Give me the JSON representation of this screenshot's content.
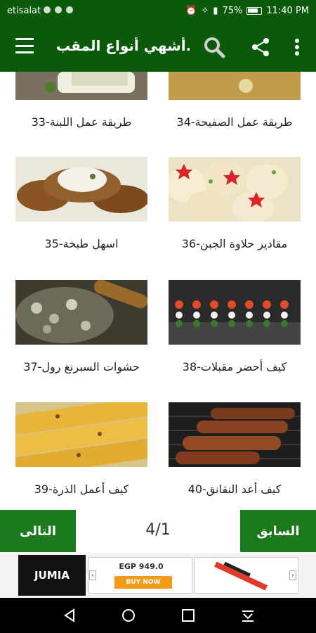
{
  "status_bar": {
    "carrier": "etisalat",
    "battery": "75%",
    "time": "11:40 PM"
  },
  "app_bar": {
    "title": "أشهي أنواع المقب.."
  },
  "tiles": [
    {
      "label": "33-طريقة عمل اللبنة"
    },
    {
      "label": "34-طريقة عمل الصفيحة"
    },
    {
      "label": "35-اسهل طبخة"
    },
    {
      "label": "36-مقادير حلاوة الجبن"
    },
    {
      "label": "37-حشوات السبرنغ رول"
    },
    {
      "label": "38-كيف أحضر مقبلات"
    },
    {
      "label": "39-كيف أعمل الذرة"
    },
    {
      "label": "40-كيف أعد النقانق"
    }
  ],
  "pager": {
    "next_label": "التالى",
    "prev_label": "السابق",
    "page_indicator": "4/1"
  },
  "ad": {
    "brand": "JUMIA",
    "price": "EGP 949.0",
    "cta": "BUY NOW"
  },
  "colors": {
    "primary": "#0b5a0b",
    "button": "#1b7a1b"
  }
}
